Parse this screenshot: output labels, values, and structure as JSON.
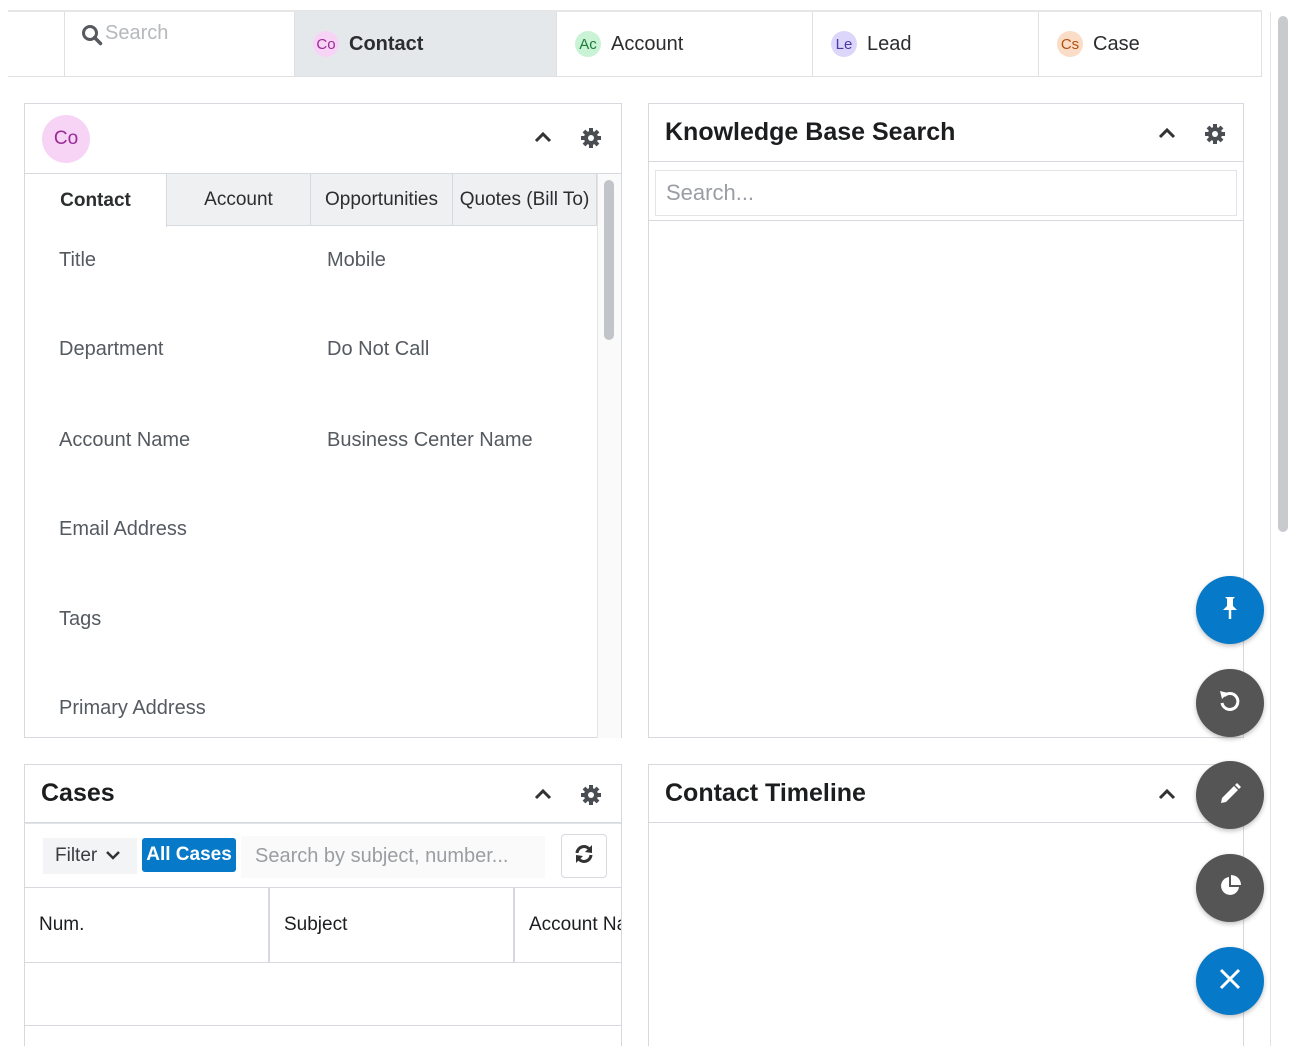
{
  "topbar": {
    "search_placeholder": "Search",
    "tabs": [
      {
        "badge": "Co",
        "label": "Contact",
        "badge_bg": "#f7d4f5",
        "badge_fg": "#9b2a96",
        "active": true
      },
      {
        "badge": "Ac",
        "label": "Account",
        "badge_bg": "#c9f3d4",
        "badge_fg": "#1c7a3b",
        "active": false
      },
      {
        "badge": "Le",
        "label": "Lead",
        "badge_bg": "#dcd6fb",
        "badge_fg": "#4a3aa8",
        "active": false
      },
      {
        "badge": "Cs",
        "label": "Case",
        "badge_bg": "#fbdcc6",
        "badge_fg": "#b34f11",
        "active": false
      }
    ]
  },
  "contact_dashlet": {
    "avatar": "Co",
    "tabs": [
      "Contact",
      "Account",
      "Opportunities",
      "Quotes (Bill To)"
    ],
    "fields_left": [
      "Title",
      "Department",
      "Account Name",
      "Email Address",
      "Tags",
      "Primary Address"
    ],
    "fields_right": [
      "Mobile",
      "Do Not Call",
      "Business Center Name"
    ]
  },
  "kb_dashlet": {
    "title": "Knowledge Base Search",
    "search_placeholder": "Search..."
  },
  "cases_dashlet": {
    "title": "Cases",
    "filter_label": "Filter",
    "filter_value": "All Cases",
    "search_placeholder": "Search by subject, number...",
    "columns": [
      "Num.",
      "Subject",
      "Account Name"
    ]
  },
  "timeline_dashlet": {
    "title": "Contact Timeline"
  },
  "fab_buttons": [
    "pin-icon",
    "undo-icon",
    "pencil-icon",
    "pie-chart-icon",
    "close-icon"
  ],
  "colors": {
    "accent": "#0679c8",
    "fab_gray": "#555555",
    "active_tab_bg": "#e5e8eb"
  }
}
